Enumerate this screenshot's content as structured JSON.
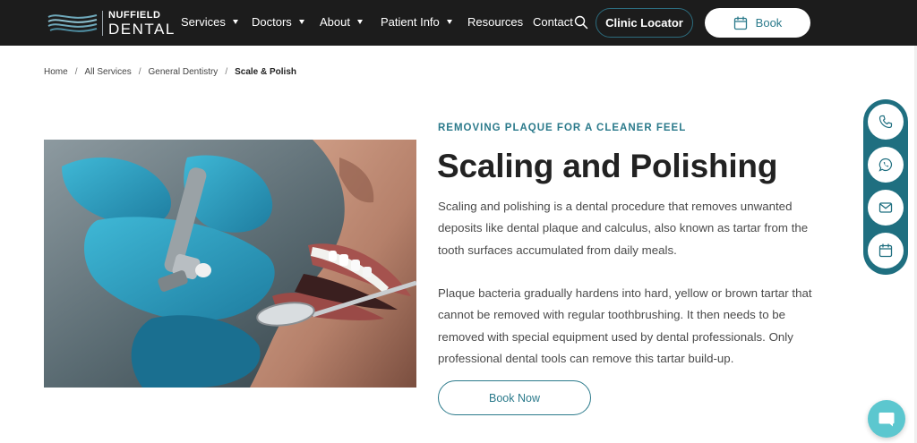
{
  "brand": {
    "top": "NUFFIELD",
    "bottom": "DENTAL",
    "color": "#2b7a8b"
  },
  "nav": {
    "items": [
      {
        "label": "Services",
        "dropdown": true
      },
      {
        "label": "Doctors",
        "dropdown": true
      },
      {
        "label": "About",
        "dropdown": true
      },
      {
        "label": "Patient Info",
        "dropdown": true
      },
      {
        "label": "Resources",
        "dropdown": false
      },
      {
        "label": "Contact",
        "dropdown": false
      }
    ],
    "clinic_locator_label": "Clinic Locator",
    "book_label": "Book",
    "search_icon": "search-icon",
    "book_icon": "calendar-icon"
  },
  "breadcrumb": {
    "items": [
      "Home",
      "All Services",
      "General Dentistry"
    ],
    "current": "Scale & Polish"
  },
  "content": {
    "eyebrow": "REMOVING PLAQUE FOR A CLEANER FEEL",
    "title": "Scaling and Polishing",
    "paragraph1": "Scaling and polishing is a dental procedure that removes unwanted deposits like dental plaque and calculus, also known as tartar from the tooth surfaces accumulated from daily meals.",
    "paragraph2": "Plaque bacteria gradually hardens into hard, yellow or brown tartar that cannot be removed with regular toothbrushing. It then needs to be removed with special equipment used by dental professionals. Only professional dental tools can remove this tartar build-up.",
    "cta_label": "Book Now"
  },
  "floating_contact": {
    "items": [
      "phone-icon",
      "whatsapp-icon",
      "mail-icon",
      "calendar-icon"
    ]
  },
  "chat": {
    "icon": "chat-icon"
  },
  "colors": {
    "header_bg": "#1c1c1c",
    "accent": "#2b7a8b",
    "float_bar": "#1f6f80",
    "chat": "#5cc7cf"
  }
}
